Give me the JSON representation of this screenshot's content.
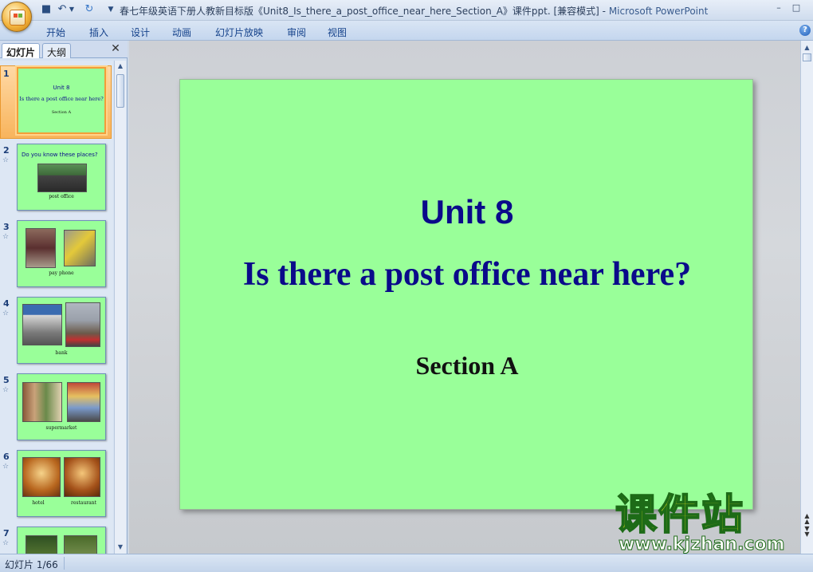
{
  "window": {
    "title": "春七年级英语下册人教新目标版《Unit8_Is_there_a_post_office_near_here_Section_A》课件ppt. [兼容模式]",
    "app_name": "Microsoft PowerPoint",
    "separator": " - "
  },
  "ribbon": {
    "tabs": [
      "开始",
      "插入",
      "设计",
      "动画",
      "幻灯片放映",
      "审阅",
      "视图"
    ]
  },
  "panel": {
    "tab_slides": "幻灯片",
    "tab_outline": "大纲"
  },
  "thumbnails": [
    {
      "number": "1",
      "line1": "Unit 8",
      "line2": "Is there a post office near here?",
      "line3": "Section A"
    },
    {
      "number": "2",
      "heading": "Do you know these places?",
      "caption": "post office"
    },
    {
      "number": "3",
      "caption": "pay phone"
    },
    {
      "number": "4",
      "caption": "bank"
    },
    {
      "number": "5",
      "caption": "supermarket"
    },
    {
      "number": "6",
      "caption_left": "hotel",
      "caption_right": "restaurant"
    },
    {
      "number": "7"
    }
  ],
  "slide": {
    "title": "Unit 8",
    "subtitle": "Is there a post office near here?",
    "section": "Section A"
  },
  "status": {
    "slide_info": "幻灯片 1/66"
  },
  "watermark": {
    "chinese": "课件站",
    "url": "www.kjzhan.com"
  },
  "colors": {
    "slide_bg": "#99ff99",
    "title_color": "#0a0a8a",
    "selection": "#f8b45c"
  }
}
